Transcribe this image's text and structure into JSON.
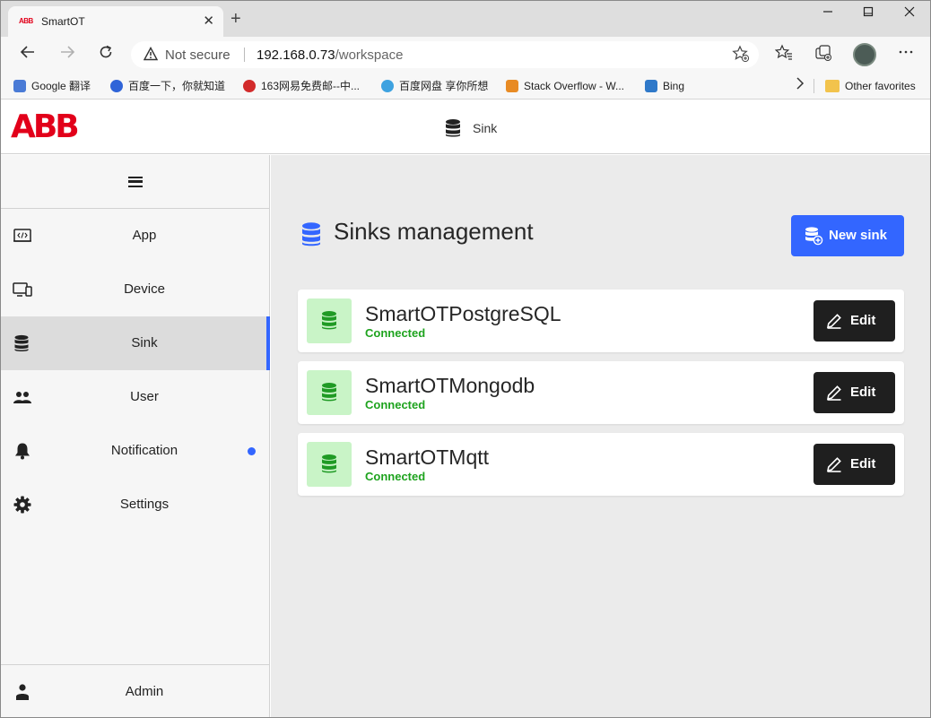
{
  "browser": {
    "tab_logo": "ABB",
    "tab_title": "SmartOT",
    "tab_close": "✕",
    "new_tab": "+",
    "address_security": "Not secure",
    "address_host": "192.168.0.73",
    "address_path": "/workspace",
    "bookmarks": [
      {
        "label": "Google 翻译",
        "color": "#4a7bd6"
      },
      {
        "label": "百度一下，你就知道",
        "color": "#2f64d8"
      },
      {
        "label": "163网易免费邮--中...",
        "color": "#d22b2b"
      },
      {
        "label": "百度网盘 享你所想",
        "color": "#3ea2e0"
      },
      {
        "label": "Stack Overflow - W...",
        "color": "#e88b24"
      },
      {
        "label": "Bing",
        "color": "#2f79c9"
      }
    ],
    "other_favorites": "Other favorites"
  },
  "app": {
    "logo": "ABB",
    "header_title": "Sink",
    "sidebar": {
      "items": [
        {
          "label": "App",
          "icon": "app-code-icon"
        },
        {
          "label": "Device",
          "icon": "device-icon"
        },
        {
          "label": "Sink",
          "icon": "database-icon",
          "active": true
        },
        {
          "label": "User",
          "icon": "users-icon"
        },
        {
          "label": "Notification",
          "icon": "bell-icon",
          "badge_dot": true
        },
        {
          "label": "Settings",
          "icon": "gear-icon"
        }
      ],
      "admin_label": "Admin"
    },
    "main": {
      "title": "Sinks management",
      "new_button": "New sink",
      "sinks": [
        {
          "name": "SmartOTPostgreSQL",
          "status": "Connected",
          "edit_label": "Edit"
        },
        {
          "name": "SmartOTMongodb",
          "status": "Connected",
          "edit_label": "Edit"
        },
        {
          "name": "SmartOTMqtt",
          "status": "Connected",
          "edit_label": "Edit"
        }
      ]
    },
    "colors": {
      "brand_red": "#e2001a",
      "accent_blue": "#3366ff",
      "status_green": "#1ea31e",
      "edit_button": "#1f1f1f"
    }
  }
}
